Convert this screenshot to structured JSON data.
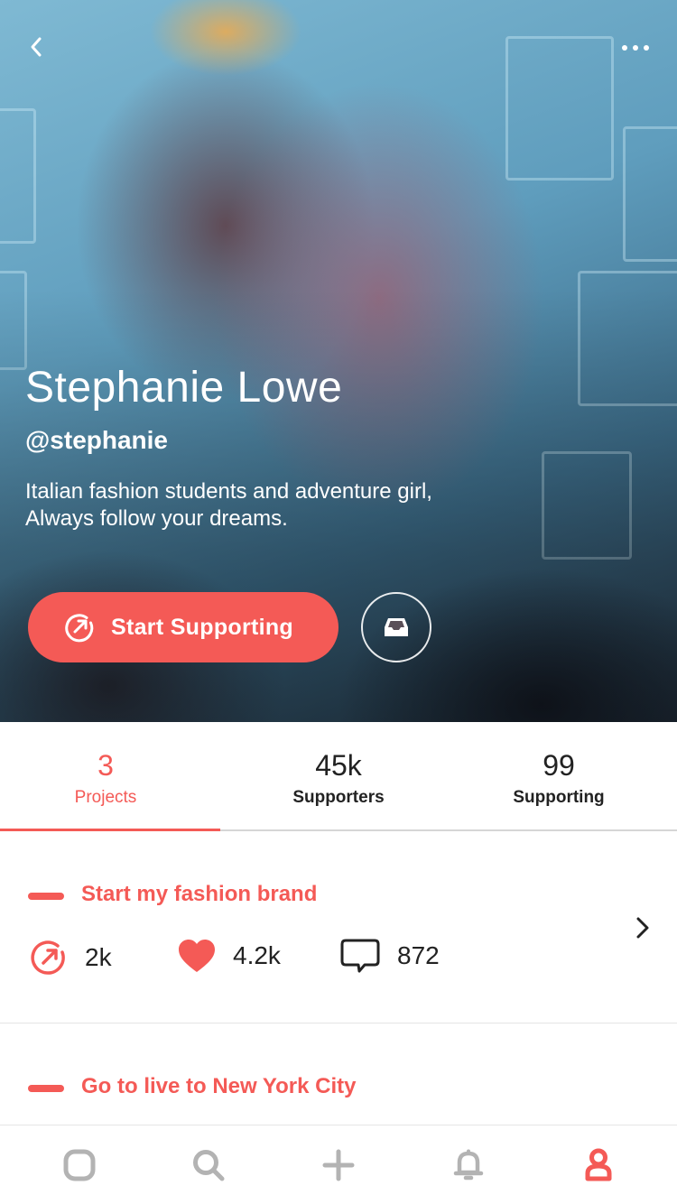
{
  "profile": {
    "name": "Stephanie Lowe",
    "handle": "@stephanie",
    "bio_lines": [
      "Italian fashion students and adventure girl,",
      "Always follow your dreams."
    ]
  },
  "actions": {
    "support_label": "Start Supporting"
  },
  "stats": [
    {
      "value": "3",
      "label": "Projects",
      "active": true
    },
    {
      "value": "45k",
      "label": "Supporters",
      "active": false
    },
    {
      "value": "99",
      "label": "Supporting",
      "active": false
    }
  ],
  "projects": [
    {
      "title": "Start my fashion brand",
      "supports": "2k",
      "likes": "4.2k",
      "comments": "872"
    },
    {
      "title": "Go to live to New York City"
    }
  ],
  "colors": {
    "accent": "#f45a56",
    "text": "#222222",
    "nav_inactive": "#b3b3b3"
  },
  "icons": {
    "back": "chevron-left-icon",
    "more": "more-horizontal-icon",
    "support": "arrow-up-right-circle-icon",
    "inbox": "inbox-icon",
    "heart": "heart-icon",
    "comment": "comment-icon",
    "chevron": "chevron-right-icon",
    "nav": [
      "home-icon",
      "search-icon",
      "plus-icon",
      "bell-icon",
      "profile-icon"
    ]
  },
  "nav": {
    "active_index": 4
  }
}
